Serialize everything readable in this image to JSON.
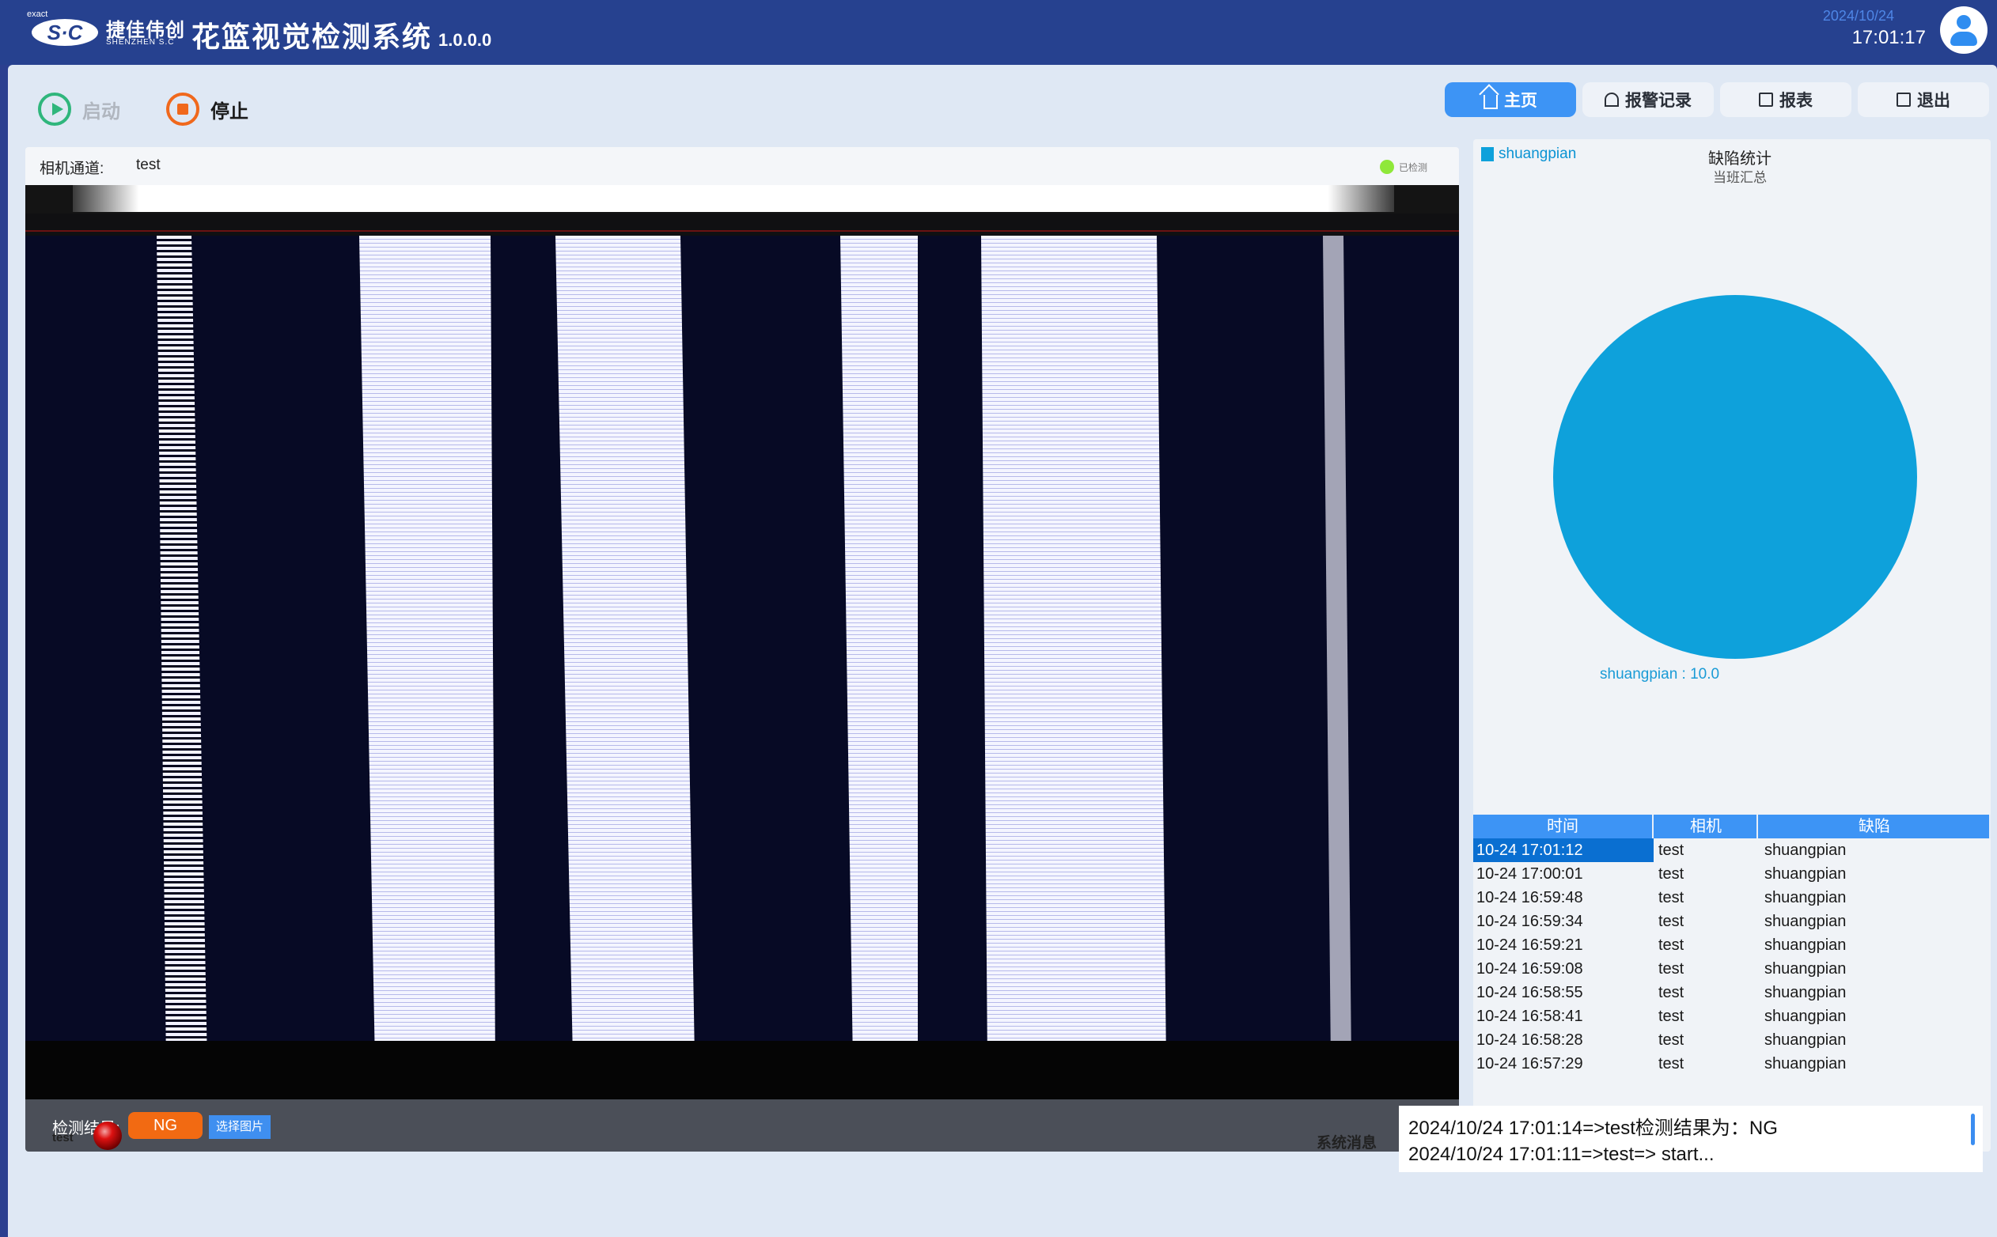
{
  "header": {
    "logo": {
      "exact": "exact",
      "badge": "S·C",
      "cn": "捷佳伟创",
      "en": "SHENZHEN S.C"
    },
    "title": "花篮视觉检测系统",
    "version": "1.0.0.0",
    "date": "2024/10/24",
    "time": "17:01:17"
  },
  "controls": {
    "start_label": "启动",
    "stop_label": "停止"
  },
  "nav": {
    "home": "主页",
    "alarms": "报警记录",
    "report": "报表",
    "exit": "退出"
  },
  "camera": {
    "channel_label": "相机通道:",
    "channel_name": "test",
    "status_text": "已检测",
    "status_color": "#8fe83a",
    "result_label": "检测结果:",
    "result_value": "NG",
    "choose_image": "选择图片"
  },
  "stats": {
    "legend": "shuangpian",
    "title": "缺陷统计",
    "subtitle": "当班汇总",
    "slice_label": "shuangpian : 10.0"
  },
  "chart_data": {
    "type": "pie",
    "title": "缺陷统计",
    "subtitle": "当班汇总",
    "slices": [
      {
        "name": "shuangpian",
        "value": 10.0,
        "color": "#0ea1db"
      }
    ]
  },
  "defect_table": {
    "headers": [
      "时间",
      "相机",
      "缺陷"
    ],
    "rows": [
      [
        "10-24 17:01:12",
        "test",
        "shuangpian"
      ],
      [
        "10-24 17:00:01",
        "test",
        "shuangpian"
      ],
      [
        "10-24 16:59:48",
        "test",
        "shuangpian"
      ],
      [
        "10-24 16:59:34",
        "test",
        "shuangpian"
      ],
      [
        "10-24 16:59:21",
        "test",
        "shuangpian"
      ],
      [
        "10-24 16:59:08",
        "test",
        "shuangpian"
      ],
      [
        "10-24 16:58:55",
        "test",
        "shuangpian"
      ],
      [
        "10-24 16:58:41",
        "test",
        "shuangpian"
      ],
      [
        "10-24 16:58:28",
        "test",
        "shuangpian"
      ],
      [
        "10-24 16:57:29",
        "test",
        "shuangpian"
      ]
    ]
  },
  "bottom": {
    "camera_name": "test",
    "system_message_label": "系统消息",
    "messages": [
      "2024/10/24 17:01:14=>test检测结果为：NG",
      "2024/10/24 17:01:11=>test=> start..."
    ]
  }
}
